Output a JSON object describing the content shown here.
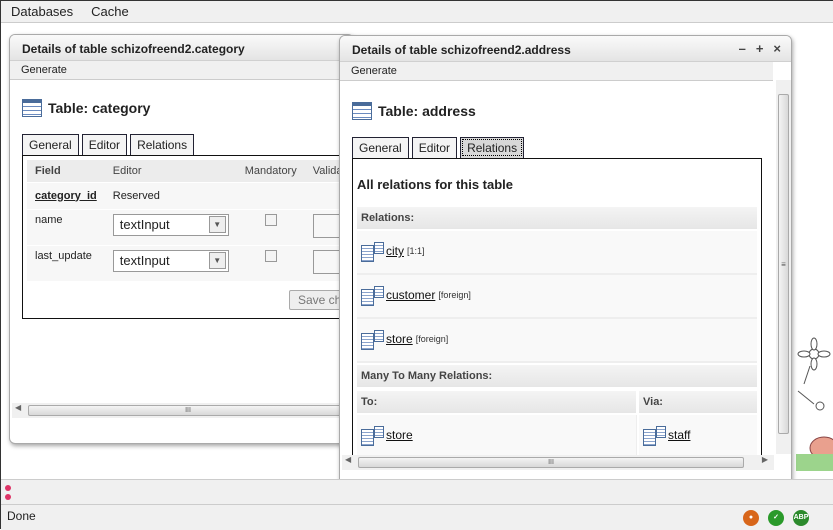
{
  "menu": [
    "Databases",
    "Cache"
  ],
  "win1": {
    "title": "Details of table schizofreend2.category",
    "generate": "Generate",
    "heading": "Table: category",
    "tabs": [
      "General",
      "Editor",
      "Relations"
    ],
    "columns": [
      "Field",
      "Editor",
      "Mandatory",
      "Validatio"
    ],
    "rows": [
      {
        "field": "category_id",
        "editor": "Reserved"
      },
      {
        "field": "name",
        "editor": "textInput"
      },
      {
        "field": "last_update",
        "editor": "textInput"
      }
    ],
    "save": "Save ch"
  },
  "win2": {
    "title": "Details of table schizofreend2.address",
    "generate": "Generate",
    "heading": "Table: address",
    "tabs": [
      "General",
      "Editor",
      "Relations"
    ],
    "section_title": "All relations for this table",
    "relations_label": "Relations:",
    "relations": [
      {
        "name": "city",
        "tag": "[1:1]"
      },
      {
        "name": "customer",
        "tag": "[foreign]"
      },
      {
        "name": "store",
        "tag": "[foreign]"
      }
    ],
    "m2m_label": "Many To Many Relations:",
    "to_label": "To:",
    "via_label": "Via:",
    "m2m": [
      {
        "to": "store",
        "via": "staff"
      }
    ],
    "controls": {
      "minimize": "–",
      "maximize": "+",
      "close": "×"
    }
  },
  "status": {
    "text": "Done"
  }
}
